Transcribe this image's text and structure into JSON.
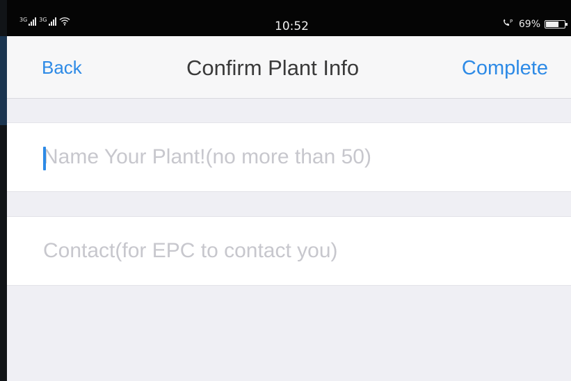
{
  "status_bar": {
    "time": "10:52",
    "battery_percent": "69%",
    "battery_level": 0.69,
    "icons": [
      "signal-icon",
      "signal-icon",
      "wifi-icon",
      "call-icon",
      "battery-icon"
    ]
  },
  "nav": {
    "back_label": "Back",
    "title": "Confirm Plant Info",
    "complete_label": "Complete"
  },
  "form": {
    "name_placeholder": "Name Your Plant!(no more than 50)",
    "name_value": "",
    "contact_placeholder": "Contact(for EPC to contact you)",
    "contact_value": ""
  },
  "colors": {
    "accent": "#2d8ae6",
    "background": "#efeff4",
    "placeholder": "#c7c7cd"
  }
}
